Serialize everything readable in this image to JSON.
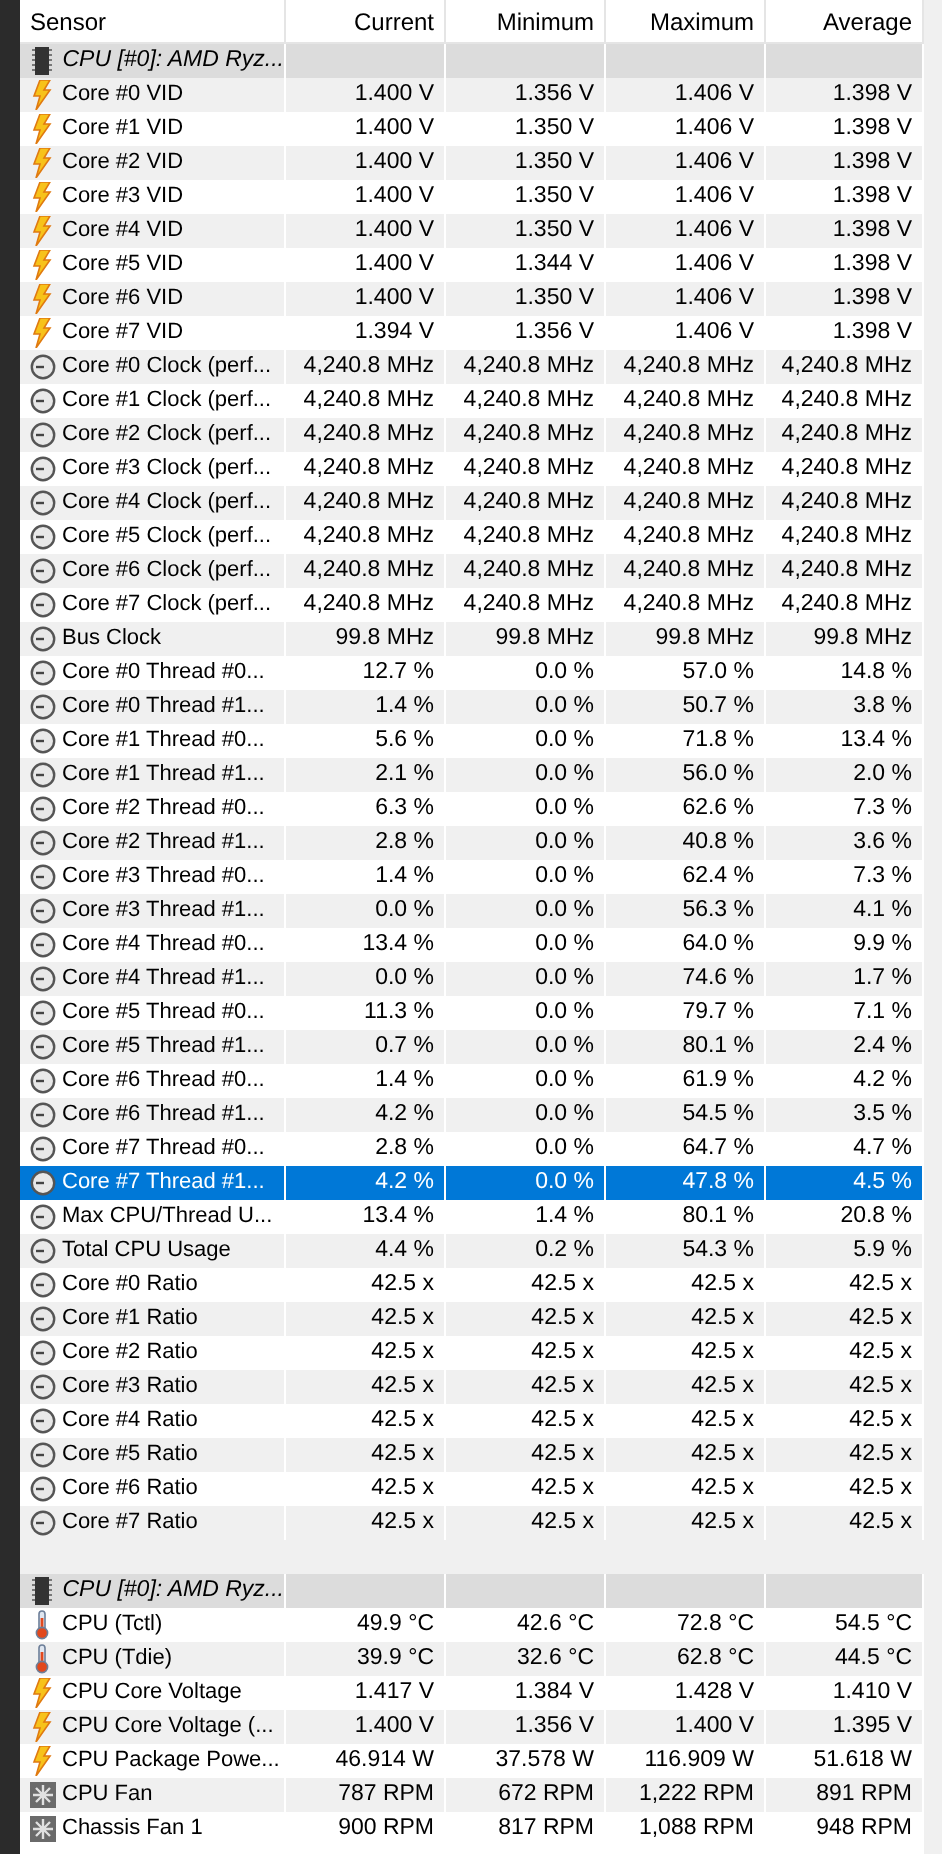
{
  "columns": [
    "Sensor",
    "Current",
    "Minimum",
    "Maximum",
    "Average"
  ],
  "sections": [
    {
      "title": "CPU [#0]: AMD Ryz...",
      "rows": [
        {
          "kind": "volt",
          "label": "Core #0 VID",
          "values": [
            "1.400 V",
            "1.356 V",
            "1.406 V",
            "1.398 V"
          ],
          "selected": false
        },
        {
          "kind": "volt",
          "label": "Core #1 VID",
          "values": [
            "1.400 V",
            "1.350 V",
            "1.406 V",
            "1.398 V"
          ],
          "selected": false
        },
        {
          "kind": "volt",
          "label": "Core #2 VID",
          "values": [
            "1.400 V",
            "1.350 V",
            "1.406 V",
            "1.398 V"
          ],
          "selected": false
        },
        {
          "kind": "volt",
          "label": "Core #3 VID",
          "values": [
            "1.400 V",
            "1.350 V",
            "1.406 V",
            "1.398 V"
          ],
          "selected": false
        },
        {
          "kind": "volt",
          "label": "Core #4 VID",
          "values": [
            "1.400 V",
            "1.350 V",
            "1.406 V",
            "1.398 V"
          ],
          "selected": false
        },
        {
          "kind": "volt",
          "label": "Core #5 VID",
          "values": [
            "1.400 V",
            "1.344 V",
            "1.406 V",
            "1.398 V"
          ],
          "selected": false
        },
        {
          "kind": "volt",
          "label": "Core #6 VID",
          "values": [
            "1.400 V",
            "1.350 V",
            "1.406 V",
            "1.398 V"
          ],
          "selected": false
        },
        {
          "kind": "volt",
          "label": "Core #7 VID",
          "values": [
            "1.394 V",
            "1.356 V",
            "1.406 V",
            "1.398 V"
          ],
          "selected": false
        },
        {
          "kind": "gauge",
          "label": "Core #0 Clock (perf...",
          "values": [
            "4,240.8 MHz",
            "4,240.8 MHz",
            "4,240.8 MHz",
            "4,240.8 MHz"
          ],
          "selected": false
        },
        {
          "kind": "gauge",
          "label": "Core #1 Clock (perf...",
          "values": [
            "4,240.8 MHz",
            "4,240.8 MHz",
            "4,240.8 MHz",
            "4,240.8 MHz"
          ],
          "selected": false
        },
        {
          "kind": "gauge",
          "label": "Core #2 Clock (perf...",
          "values": [
            "4,240.8 MHz",
            "4,240.8 MHz",
            "4,240.8 MHz",
            "4,240.8 MHz"
          ],
          "selected": false
        },
        {
          "kind": "gauge",
          "label": "Core #3 Clock (perf...",
          "values": [
            "4,240.8 MHz",
            "4,240.8 MHz",
            "4,240.8 MHz",
            "4,240.8 MHz"
          ],
          "selected": false
        },
        {
          "kind": "gauge",
          "label": "Core #4 Clock (perf...",
          "values": [
            "4,240.8 MHz",
            "4,240.8 MHz",
            "4,240.8 MHz",
            "4,240.8 MHz"
          ],
          "selected": false
        },
        {
          "kind": "gauge",
          "label": "Core #5 Clock (perf...",
          "values": [
            "4,240.8 MHz",
            "4,240.8 MHz",
            "4,240.8 MHz",
            "4,240.8 MHz"
          ],
          "selected": false
        },
        {
          "kind": "gauge",
          "label": "Core #6 Clock (perf...",
          "values": [
            "4,240.8 MHz",
            "4,240.8 MHz",
            "4,240.8 MHz",
            "4,240.8 MHz"
          ],
          "selected": false
        },
        {
          "kind": "gauge",
          "label": "Core #7 Clock (perf...",
          "values": [
            "4,240.8 MHz",
            "4,240.8 MHz",
            "4,240.8 MHz",
            "4,240.8 MHz"
          ],
          "selected": false
        },
        {
          "kind": "gauge",
          "label": "Bus Clock",
          "values": [
            "99.8 MHz",
            "99.8 MHz",
            "99.8 MHz",
            "99.8 MHz"
          ],
          "selected": false
        },
        {
          "kind": "gauge",
          "label": "Core #0 Thread #0...",
          "values": [
            "12.7 %",
            "0.0 %",
            "57.0 %",
            "14.8 %"
          ],
          "selected": false
        },
        {
          "kind": "gauge",
          "label": "Core #0 Thread #1...",
          "values": [
            "1.4 %",
            "0.0 %",
            "50.7 %",
            "3.8 %"
          ],
          "selected": false
        },
        {
          "kind": "gauge",
          "label": "Core #1 Thread #0...",
          "values": [
            "5.6 %",
            "0.0 %",
            "71.8 %",
            "13.4 %"
          ],
          "selected": false
        },
        {
          "kind": "gauge",
          "label": "Core #1 Thread #1...",
          "values": [
            "2.1 %",
            "0.0 %",
            "56.0 %",
            "2.0 %"
          ],
          "selected": false
        },
        {
          "kind": "gauge",
          "label": "Core #2 Thread #0...",
          "values": [
            "6.3 %",
            "0.0 %",
            "62.6 %",
            "7.3 %"
          ],
          "selected": false
        },
        {
          "kind": "gauge",
          "label": "Core #2 Thread #1...",
          "values": [
            "2.8 %",
            "0.0 %",
            "40.8 %",
            "3.6 %"
          ],
          "selected": false
        },
        {
          "kind": "gauge",
          "label": "Core #3 Thread #0...",
          "values": [
            "1.4 %",
            "0.0 %",
            "62.4 %",
            "7.3 %"
          ],
          "selected": false
        },
        {
          "kind": "gauge",
          "label": "Core #3 Thread #1...",
          "values": [
            "0.0 %",
            "0.0 %",
            "56.3 %",
            "4.1 %"
          ],
          "selected": false
        },
        {
          "kind": "gauge",
          "label": "Core #4 Thread #0...",
          "values": [
            "13.4 %",
            "0.0 %",
            "64.0 %",
            "9.9 %"
          ],
          "selected": false
        },
        {
          "kind": "gauge",
          "label": "Core #4 Thread #1...",
          "values": [
            "0.0 %",
            "0.0 %",
            "74.6 %",
            "1.7 %"
          ],
          "selected": false
        },
        {
          "kind": "gauge",
          "label": "Core #5 Thread #0...",
          "values": [
            "11.3 %",
            "0.0 %",
            "79.7 %",
            "7.1 %"
          ],
          "selected": false
        },
        {
          "kind": "gauge",
          "label": "Core #5 Thread #1...",
          "values": [
            "0.7 %",
            "0.0 %",
            "80.1 %",
            "2.4 %"
          ],
          "selected": false
        },
        {
          "kind": "gauge",
          "label": "Core #6 Thread #0...",
          "values": [
            "1.4 %",
            "0.0 %",
            "61.9 %",
            "4.2 %"
          ],
          "selected": false
        },
        {
          "kind": "gauge",
          "label": "Core #6 Thread #1...",
          "values": [
            "4.2 %",
            "0.0 %",
            "54.5 %",
            "3.5 %"
          ],
          "selected": false
        },
        {
          "kind": "gauge",
          "label": "Core #7 Thread #0...",
          "values": [
            "2.8 %",
            "0.0 %",
            "64.7 %",
            "4.7 %"
          ],
          "selected": false
        },
        {
          "kind": "gauge",
          "label": "Core #7 Thread #1...",
          "values": [
            "4.2 %",
            "0.0 %",
            "47.8 %",
            "4.5 %"
          ],
          "selected": true
        },
        {
          "kind": "gauge",
          "label": "Max CPU/Thread U...",
          "values": [
            "13.4 %",
            "1.4 %",
            "80.1 %",
            "20.8 %"
          ],
          "selected": false
        },
        {
          "kind": "gauge",
          "label": "Total CPU Usage",
          "values": [
            "4.4 %",
            "0.2 %",
            "54.3 %",
            "5.9 %"
          ],
          "selected": false
        },
        {
          "kind": "gauge",
          "label": "Core #0 Ratio",
          "values": [
            "42.5 x",
            "42.5 x",
            "42.5 x",
            "42.5 x"
          ],
          "selected": false
        },
        {
          "kind": "gauge",
          "label": "Core #1 Ratio",
          "values": [
            "42.5 x",
            "42.5 x",
            "42.5 x",
            "42.5 x"
          ],
          "selected": false
        },
        {
          "kind": "gauge",
          "label": "Core #2 Ratio",
          "values": [
            "42.5 x",
            "42.5 x",
            "42.5 x",
            "42.5 x"
          ],
          "selected": false
        },
        {
          "kind": "gauge",
          "label": "Core #3 Ratio",
          "values": [
            "42.5 x",
            "42.5 x",
            "42.5 x",
            "42.5 x"
          ],
          "selected": false
        },
        {
          "kind": "gauge",
          "label": "Core #4 Ratio",
          "values": [
            "42.5 x",
            "42.5 x",
            "42.5 x",
            "42.5 x"
          ],
          "selected": false
        },
        {
          "kind": "gauge",
          "label": "Core #5 Ratio",
          "values": [
            "42.5 x",
            "42.5 x",
            "42.5 x",
            "42.5 x"
          ],
          "selected": false
        },
        {
          "kind": "gauge",
          "label": "Core #6 Ratio",
          "values": [
            "42.5 x",
            "42.5 x",
            "42.5 x",
            "42.5 x"
          ],
          "selected": false
        },
        {
          "kind": "gauge",
          "label": "Core #7 Ratio",
          "values": [
            "42.5 x",
            "42.5 x",
            "42.5 x",
            "42.5 x"
          ],
          "selected": false
        }
      ]
    },
    {
      "title": "CPU [#0]: AMD Ryz...",
      "rows": [
        {
          "kind": "temp",
          "label": "CPU (Tctl)",
          "values": [
            "49.9 °C",
            "42.6 °C",
            "72.8 °C",
            "54.5 °C"
          ],
          "selected": false
        },
        {
          "kind": "temp",
          "label": "CPU (Tdie)",
          "values": [
            "39.9 °C",
            "32.6 °C",
            "62.8 °C",
            "44.5 °C"
          ],
          "selected": false
        },
        {
          "kind": "volt",
          "label": "CPU Core Voltage",
          "values": [
            "1.417 V",
            "1.384 V",
            "1.428 V",
            "1.410 V"
          ],
          "selected": false
        },
        {
          "kind": "volt",
          "label": "CPU Core Voltage (...",
          "values": [
            "1.400 V",
            "1.356 V",
            "1.400 V",
            "1.395 V"
          ],
          "selected": false
        },
        {
          "kind": "volt",
          "label": "CPU Package Powe...",
          "values": [
            "46.914 W",
            "37.578 W",
            "116.909 W",
            "51.618 W"
          ],
          "selected": false
        },
        {
          "kind": "fan",
          "label": "CPU Fan",
          "values": [
            "787 RPM",
            "672 RPM",
            "1,222 RPM",
            "891 RPM"
          ],
          "selected": false
        },
        {
          "kind": "fan",
          "label": "Chassis Fan 1",
          "values": [
            "900 RPM",
            "817 RPM",
            "1,088 RPM",
            "948 RPM"
          ],
          "selected": false
        }
      ]
    }
  ]
}
